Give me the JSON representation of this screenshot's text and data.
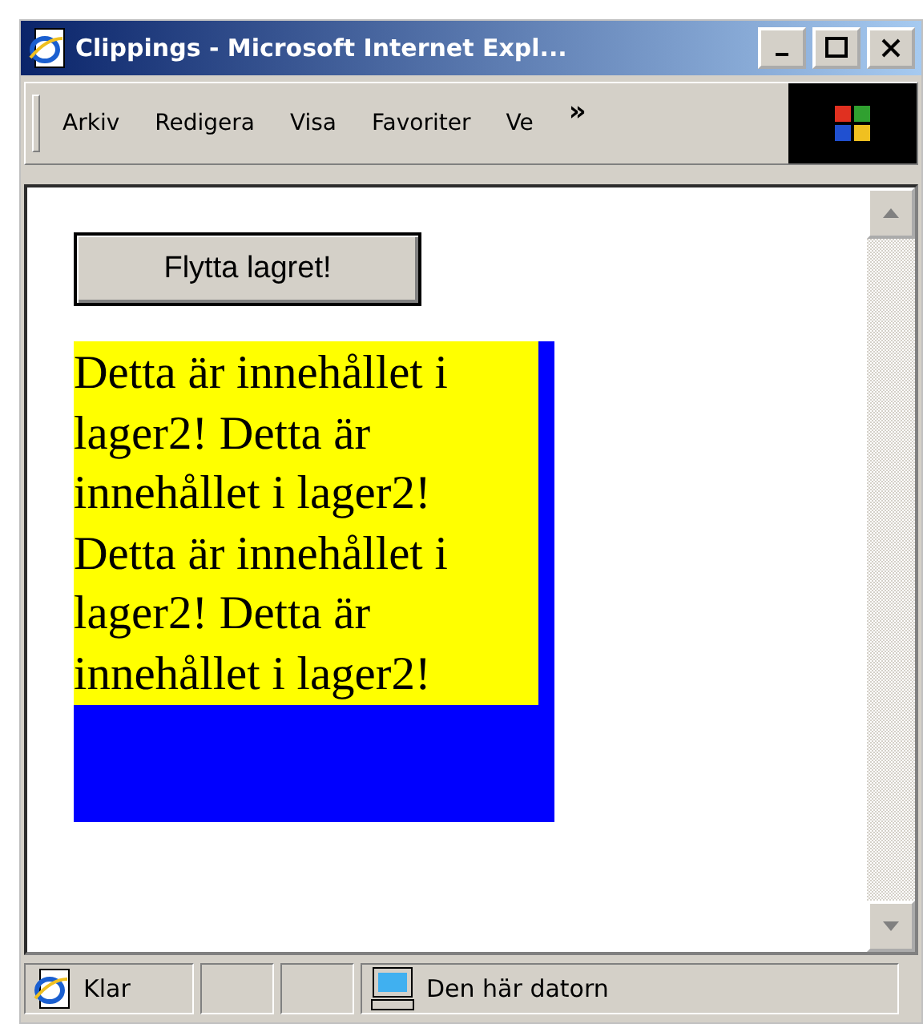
{
  "window": {
    "title": "Clippings - Microsoft Internet Expl..."
  },
  "menu": [
    {
      "label": "Arkiv"
    },
    {
      "label": "Redigera"
    },
    {
      "label": "Visa"
    },
    {
      "label": "Favoriter"
    },
    {
      "label": "Ve"
    }
  ],
  "menu_overflow": "»",
  "page": {
    "button": "Flytta lagret!",
    "layer_text": "Detta är innehållet i lager2! Detta är innehållet i lager2! Detta är innehållet i lager2! Detta är innehållet i lager2!"
  },
  "status_bar": {
    "status": "Klar",
    "zone": "Den här datorn"
  }
}
